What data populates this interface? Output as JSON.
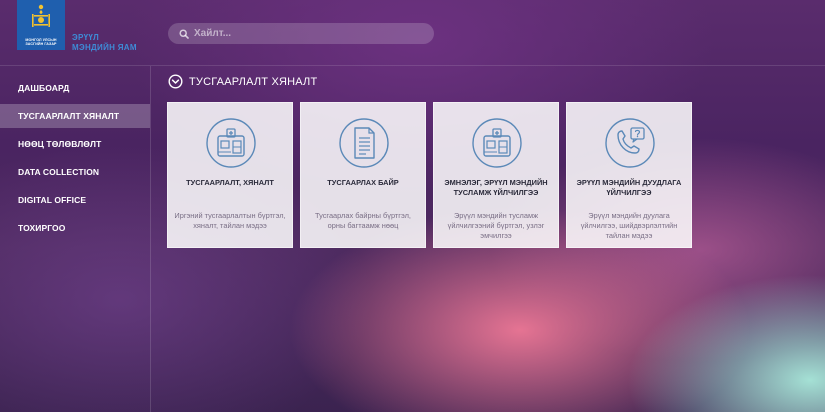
{
  "header": {
    "logo_text": "МОНГОЛ УЛСЫН ЗАСГИЙН ГАЗАР",
    "brand_line1": "ЭРҮҮЛ",
    "brand_line2": "МЭНДИЙН ЯАМ",
    "search_placeholder": "Хайлт..."
  },
  "sidebar": {
    "items": [
      {
        "label": "ДАШБОАРД",
        "active": false
      },
      {
        "label": "ТУСГААРЛАЛТ ХЯНАЛТ",
        "active": true
      },
      {
        "label": "НӨӨЦ ТӨЛӨВЛӨЛТ",
        "active": false
      },
      {
        "label": "DATA COLLECTION",
        "active": false
      },
      {
        "label": "DIGITAL OFFICE",
        "active": false
      },
      {
        "label": "ТОХИРГОО",
        "active": false
      }
    ]
  },
  "main": {
    "section_title": "ТУСГААРЛАЛТ ХЯНАЛТ",
    "cards": [
      {
        "icon": "hospital-icon",
        "title": "ТУСГААРЛАЛТ, ХЯНАЛТ",
        "description": "Иргэний тусгаарлалтын бүртгэл, хяналт, тайлан мэдээ"
      },
      {
        "icon": "document-icon",
        "title": "ТУСГААРЛАХ БАЙР",
        "description": "Тусгаарлах байрны бүртгэл, орны багтаамж нөөц"
      },
      {
        "icon": "hospital-icon",
        "title": "ЭМНЭЛЭГ, ЭРҮҮЛ МЭНДИЙН ТУСЛАМЖ ҮЙЛЧИЛГЭЭ",
        "description": "Эрүүл мэндийн тусламж үйлчилгээний бүртгэл, узлэг эмчилгээ"
      },
      {
        "icon": "phone-question-icon",
        "title": "ЭРҮҮЛ МЭНДИЙН ДУУДЛАГА ҮЙЛЧИЛГЭЭ",
        "description": "Эрүүл мэндийн дуулага үйлчилгээ, шийдвэрлэлтийн тайлан мэдээ"
      }
    ]
  },
  "colors": {
    "accent_blue": "#1f5fae",
    "brand_text": "#3e8bd6",
    "icon_stroke": "#5b89b8",
    "card_title": "#2a2a3a"
  }
}
